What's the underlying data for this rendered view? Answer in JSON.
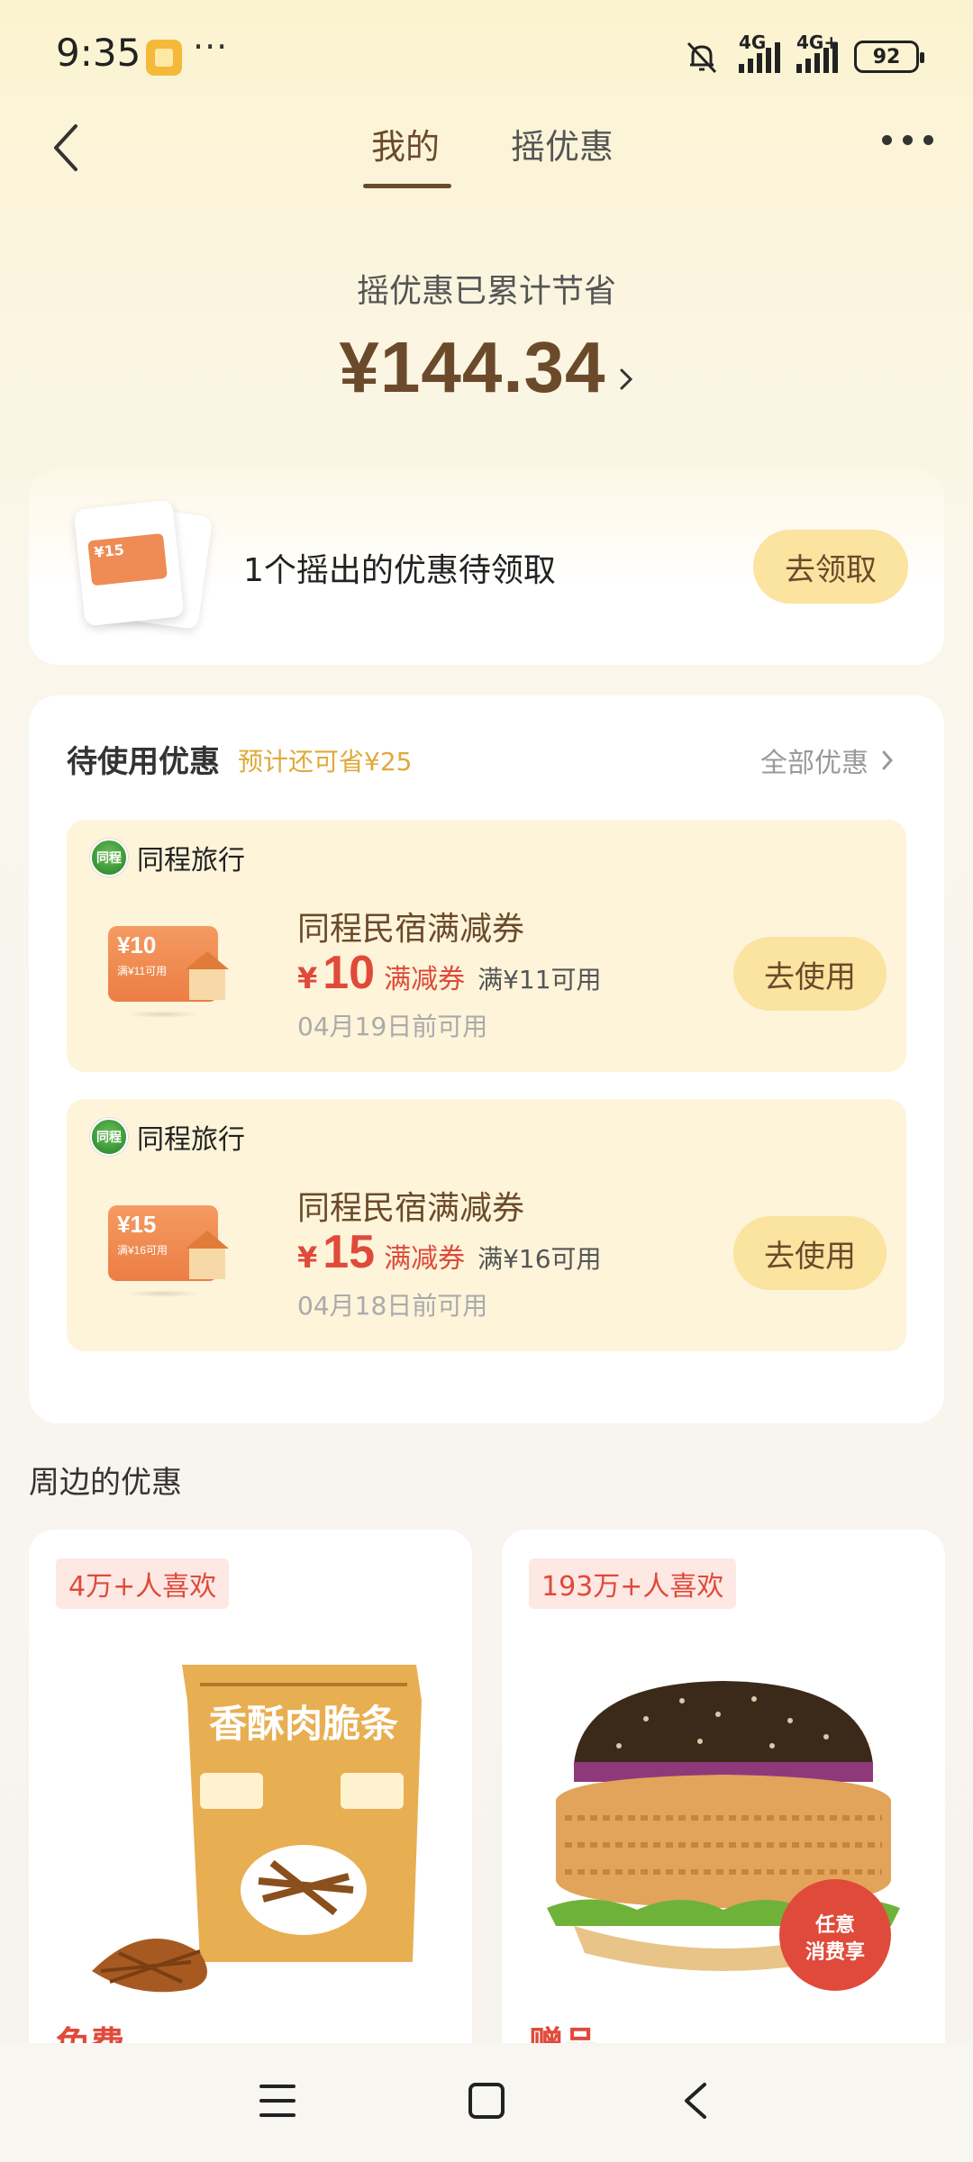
{
  "status_bar": {
    "time": "9:35",
    "more": "···",
    "network1": "4G",
    "network2": "4G+",
    "battery": "92"
  },
  "header": {
    "tabs": [
      {
        "label": "我的",
        "active": true
      },
      {
        "label": "摇优惠",
        "active": false
      }
    ]
  },
  "savings": {
    "title": "摇优惠已累计节省",
    "amount": "¥144.34"
  },
  "pending": {
    "text": "1个摇出的优惠待领取",
    "button": "去领取",
    "thumb_value": "¥15"
  },
  "vouchers": {
    "title": "待使用优惠",
    "subtitle": "预计还可省¥25",
    "all_link": "全部优惠",
    "items": [
      {
        "merchant": "同程旅行",
        "logo_text": "同程",
        "thumb_value": "¥10",
        "thumb_cond": "满¥11可用",
        "title": "同程民宿满减券",
        "currency": "¥",
        "value": "10",
        "kind": "满减券",
        "condition": "满¥11可用",
        "expiry": "04月19日前可用",
        "button": "去使用"
      },
      {
        "merchant": "同程旅行",
        "logo_text": "同程",
        "thumb_value": "¥15",
        "thumb_cond": "满¥16可用",
        "title": "同程民宿满减券",
        "currency": "¥",
        "value": "15",
        "kind": "满减券",
        "condition": "满¥16可用",
        "expiry": "04月18日前可用",
        "button": "去使用"
      }
    ]
  },
  "nearby": {
    "title": "周边的优惠",
    "products": [
      {
        "badge": "4万+人喜欢",
        "image_text": "香酥肉脆条",
        "tag": "免费"
      },
      {
        "badge": "193万+人喜欢",
        "image_text": "任意消费享",
        "tag": "赠品"
      }
    ]
  },
  "colors": {
    "brand_brown": "#6b4a2b",
    "accent_red": "#e04a3a",
    "button_yellow": "#fbe3a0",
    "voucher_bg": "#fdf4da"
  }
}
